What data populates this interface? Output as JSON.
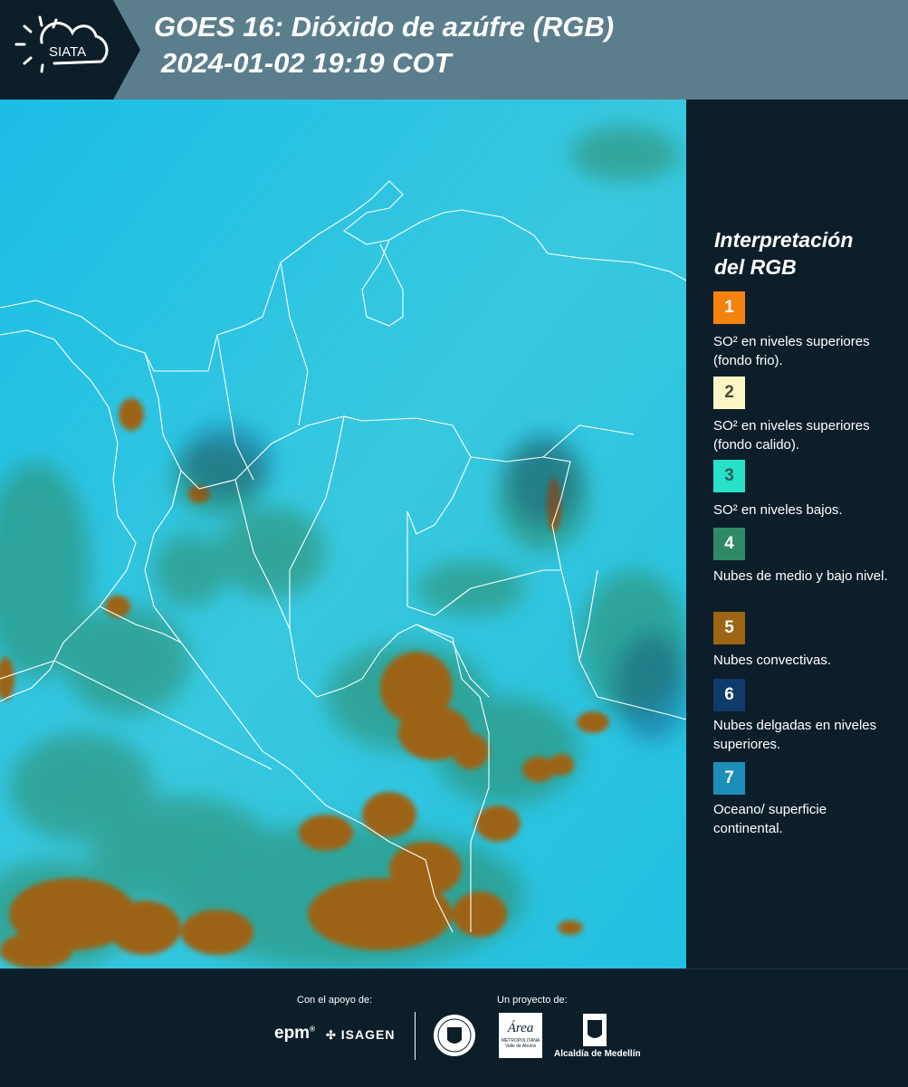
{
  "header": {
    "logo_text": "SIATA",
    "title_line1": "GOES 16: Dióxido de azúfre (RGB)",
    "title_line2": "2024-01-02 19:19 COT"
  },
  "legend": {
    "title_line1": "Interpretación",
    "title_line2": "del RGB",
    "items": [
      {
        "num": "1",
        "color": "#f4820f",
        "text_color": "#ffffff",
        "label": "SO² en niveles superiores (fondo frio)."
      },
      {
        "num": "2",
        "color": "#fdf6c4",
        "text_color": "#4a4a3a",
        "label": "SO² en niveles superiores (fondo calido)."
      },
      {
        "num": "3",
        "color": "#27e0c6",
        "text_color": "#2a5f57",
        "label": "SO² en niveles bajos."
      },
      {
        "num": "4",
        "color": "#2f8a64",
        "text_color": "#ffffff",
        "label": "Nubes de medio y bajo nivel."
      },
      {
        "num": "5",
        "color": "#9c6413",
        "text_color": "#ffffff",
        "label": "Nubes convectivas."
      },
      {
        "num": "6",
        "color": "#103a6a",
        "text_color": "#ffffff",
        "label": "Nubes delgadas en niveles superiores."
      },
      {
        "num": "7",
        "color": "#1b8fb8",
        "text_color": "#ffffff",
        "label": "Oceano/ superficie continental."
      }
    ]
  },
  "footer": {
    "support_label": "Con el apoyo de:",
    "project_label": "Un proyecto de:",
    "epm_text": "epm",
    "isagen_text": "ISAGEN",
    "area_text": "Área",
    "metropolitana_text": "METROPOLITANA",
    "valle_text": "Valle de Aburrá",
    "alcaldia_text": "Alcaldía de Medellín"
  },
  "colors": {
    "header_bg": "#5b7e8d",
    "panel_bg": "#0d1e2b",
    "ocean_cyan": "#1fc2e4",
    "cloud_mid": "#2f8a64",
    "cloud_convective": "#9c6413"
  }
}
